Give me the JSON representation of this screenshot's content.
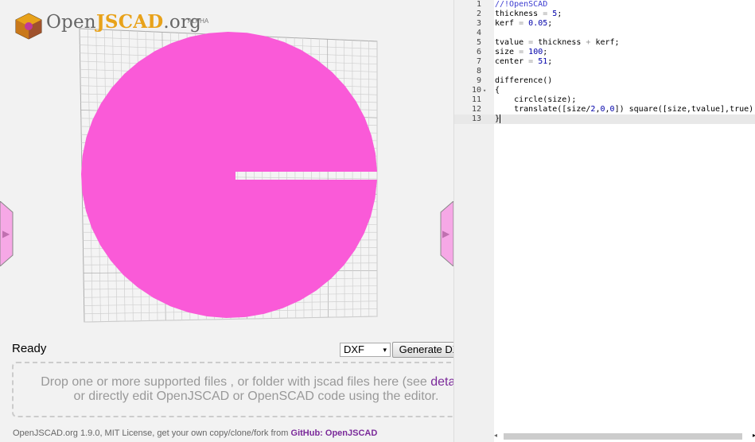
{
  "app": {
    "logo_prefix": "Open",
    "logo_jscad": "JSCAD",
    "logo_suffix": ".org",
    "logo_badge": "ALPHA"
  },
  "colors": {
    "shape_fill": "#fa5ad8",
    "accent_link": "#7b2a9a",
    "logo_orange": "#e8a21a"
  },
  "viewer": {
    "left_tab_icon": "▶",
    "right_tab_icon": "▶"
  },
  "status": {
    "text": "Ready"
  },
  "export": {
    "format_value": "DXF",
    "format_arrow": "▾",
    "generate_label": "Generate DXF"
  },
  "dropzone": {
    "line1_pre": "Drop one or more supported files , or folder with jscad files here (see ",
    "line1_link": "details",
    "line1_post": ")",
    "line2": "or directly edit OpenJSCAD or OpenSCAD code using the editor."
  },
  "footer": {
    "text": "OpenJSCAD.org 1.9.0, MIT License, get your own copy/clone/fork from ",
    "link": "GitHub: OpenJSCAD"
  },
  "editor": {
    "lines": [
      {
        "num": "1",
        "tokens": [
          {
            "t": "//!OpenSCAD",
            "c": "c-com"
          }
        ]
      },
      {
        "num": "2",
        "tokens": [
          {
            "t": "thickness "
          },
          {
            "t": "=",
            "c": "c-op"
          },
          {
            "t": " "
          },
          {
            "t": "5",
            "c": "c-num"
          },
          {
            "t": ";"
          }
        ]
      },
      {
        "num": "3",
        "tokens": [
          {
            "t": "kerf "
          },
          {
            "t": "=",
            "c": "c-op"
          },
          {
            "t": " "
          },
          {
            "t": "0.05",
            "c": "c-num"
          },
          {
            "t": ";"
          }
        ]
      },
      {
        "num": "4",
        "tokens": []
      },
      {
        "num": "5",
        "tokens": [
          {
            "t": "tvalue "
          },
          {
            "t": "=",
            "c": "c-op"
          },
          {
            "t": " thickness "
          },
          {
            "t": "+",
            "c": "c-op"
          },
          {
            "t": " kerf;"
          }
        ]
      },
      {
        "num": "6",
        "tokens": [
          {
            "t": "size "
          },
          {
            "t": "=",
            "c": "c-op"
          },
          {
            "t": " "
          },
          {
            "t": "100",
            "c": "c-num"
          },
          {
            "t": ";"
          }
        ]
      },
      {
        "num": "7",
        "tokens": [
          {
            "t": "center "
          },
          {
            "t": "=",
            "c": "c-op"
          },
          {
            "t": " "
          },
          {
            "t": "51",
            "c": "c-num"
          },
          {
            "t": ";"
          }
        ]
      },
      {
        "num": "8",
        "tokens": []
      },
      {
        "num": "9",
        "tokens": [
          {
            "t": "difference()"
          }
        ]
      },
      {
        "num": "10",
        "fold": "▾",
        "tokens": [
          {
            "t": "{"
          }
        ]
      },
      {
        "num": "11",
        "tokens": [
          {
            "t": "    circle(size);"
          }
        ]
      },
      {
        "num": "12",
        "tokens": [
          {
            "t": "    translate([size/"
          },
          {
            "t": "2",
            "c": "c-num"
          },
          {
            "t": ","
          },
          {
            "t": "0",
            "c": "c-num"
          },
          {
            "t": ","
          },
          {
            "t": "0",
            "c": "c-num"
          },
          {
            "t": "]) square([size,tvalue],true);"
          }
        ]
      },
      {
        "num": "13",
        "active": true,
        "tokens": [
          {
            "t": "}"
          }
        ]
      }
    ],
    "scroll_left_icon": "◂",
    "scroll_right_icon": "▸"
  }
}
